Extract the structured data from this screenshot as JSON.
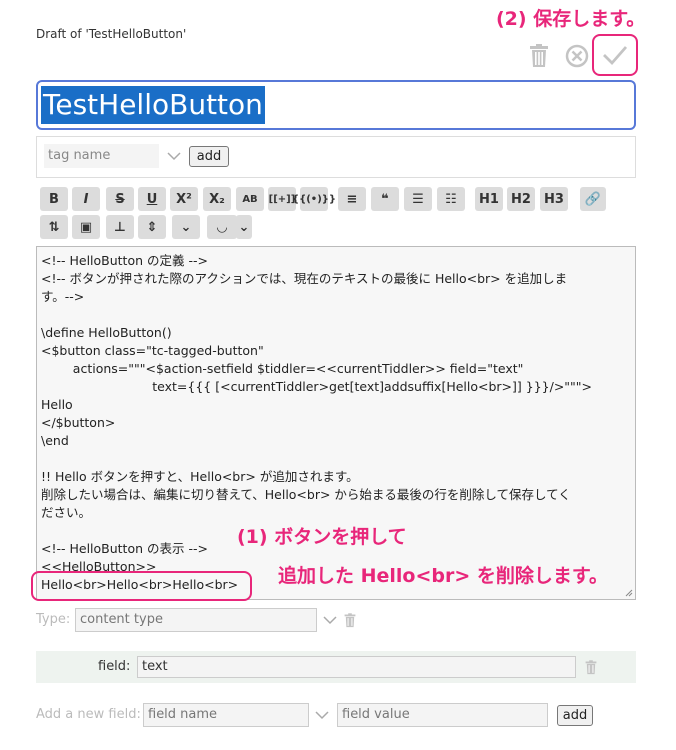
{
  "draft_title": "Draft of 'TestHelloButton'",
  "annotations": {
    "save": "(2) 保存します。",
    "step1_line1": "(1) ボタンを押して",
    "step1_line2": "追加した Hello<br> を削除します。"
  },
  "toolbar_top": {
    "icons": [
      "trash-icon",
      "cancel-icon",
      "done-check-icon"
    ]
  },
  "title_value": "TestHelloButton",
  "tags": {
    "placeholder": "tag name",
    "add_label": "add"
  },
  "editor_toolbar": {
    "row1": [
      {
        "name": "bold",
        "label": "B"
      },
      {
        "name": "italic",
        "label": "I"
      },
      {
        "name": "strikethrough",
        "label": "S"
      },
      {
        "name": "underline",
        "label": "U"
      },
      {
        "name": "superscript",
        "label": "X²"
      },
      {
        "name": "subscript",
        "label": "X₂"
      },
      {
        "name": "smallcaps",
        "label": "AB"
      },
      {
        "name": "transcludify",
        "label": "[[+]]"
      },
      {
        "name": "wikitext-macro",
        "label": "{{(•)}}"
      },
      {
        "name": "mono-block",
        "label": "≡"
      },
      {
        "name": "quote",
        "label": "❝"
      },
      {
        "name": "list-bullet",
        "label": "☰"
      },
      {
        "name": "list-number",
        "label": "☷"
      },
      {
        "name": "heading-1",
        "label": "H1"
      },
      {
        "name": "heading-2",
        "label": "H2"
      },
      {
        "name": "heading-3",
        "label": "H3"
      },
      {
        "name": "link",
        "label": "🔗"
      }
    ],
    "row2": [
      {
        "name": "excise",
        "label": "⇅"
      },
      {
        "name": "picture",
        "label": "▣"
      },
      {
        "name": "stamp",
        "label": "⊥"
      },
      {
        "name": "size",
        "label": "⇕"
      },
      {
        "name": "more",
        "label": "⌄"
      },
      {
        "name": "preview",
        "label": "◡"
      },
      {
        "name": "preview-type",
        "label": "⌄"
      }
    ]
  },
  "editor_lines": [
    "<!-- HelloButton の定義 -->",
    "<!-- ボタンが押された際のアクションでは、現在のテキストの最後に Hello<br> を追加しま",
    "す。-->",
    "",
    "\\define HelloButton()",
    "<$button class=\"tc-tagged-button\"",
    "        actions=\"\"\"<$action-setfield $tiddler=<<currentTiddler>> field=\"text\"",
    "                            text={{{ [<currentTiddler>get[text]addsuffix[Hello<br>]] }}}/>\"\"\">",
    "Hello",
    "</$button>",
    "\\end",
    "",
    "!! Hello ボタンを押すと、Hello<br> が追加されます。",
    "削除したい場合は、編集に切り替えて、Hello<br> から始まる最後の行を削除して保存してく",
    "ださい。",
    "",
    "<!-- HelloButton の表示 -->",
    "<<HelloButton>>",
    "Hello<br>Hello<br>Hello<br>"
  ],
  "type_field": {
    "label": "Type:",
    "placeholder": "content type"
  },
  "fields": [
    {
      "name": "field:",
      "value": "text"
    }
  ],
  "new_field": {
    "label": "Add a new field:",
    "name_placeholder": "field name",
    "value_placeholder": "field value",
    "add_label": "add"
  },
  "colors": {
    "accent": "#e8267a",
    "selection": "#1a6ec7",
    "focus_border": "#5778d8"
  }
}
